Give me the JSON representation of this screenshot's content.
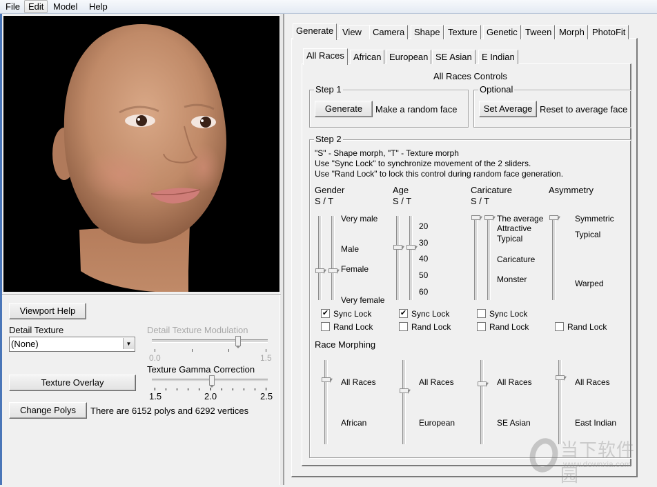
{
  "menu": {
    "items": [
      "File",
      "Edit",
      "Model",
      "Help"
    ],
    "active": "Edit"
  },
  "left_panel": {
    "viewport_help_button": "Viewport Help",
    "detail_texture": {
      "label": "Detail Texture",
      "selected": "(None)"
    },
    "detail_texture_modulation": {
      "label": "Detail Texture Modulation",
      "min_label": "0.0",
      "max_label": "1.5",
      "value_fraction": 0.73,
      "enabled": false
    },
    "texture_overlay_button": "Texture Overlay",
    "texture_gamma_correction": {
      "label": "Texture Gamma Correction",
      "min_label": "1.5",
      "mid_label": "2.0",
      "max_label": "2.5",
      "value": 2.0
    },
    "change_polys_button": "Change Polys",
    "polys_info": "There are 6152 polys and 6292 vertices"
  },
  "main_tabs": [
    {
      "label": "Generate",
      "active": true
    },
    {
      "label": "View"
    },
    {
      "label": "Camera"
    },
    {
      "label": "Shape"
    },
    {
      "label": "Texture"
    },
    {
      "label": "Genetic"
    },
    {
      "label": "Tween"
    },
    {
      "label": "Morph"
    },
    {
      "label": "PhotoFit"
    }
  ],
  "sub_tabs": [
    {
      "label": "All Races",
      "active": true
    },
    {
      "label": "African"
    },
    {
      "label": "European"
    },
    {
      "label": "SE Asian"
    },
    {
      "label": "E Indian"
    }
  ],
  "controls": {
    "title": "All Races Controls",
    "step1": {
      "title": "Step 1",
      "button": "Generate",
      "description": "Make a random face"
    },
    "optional": {
      "title": "Optional",
      "button": "Set Average",
      "description": "Reset to average face"
    },
    "step2": {
      "title": "Step 2",
      "help_lines": [
        "\"S\" - Shape morph, \"T\" - Texture morph",
        "Use \"Sync Lock\" to synchronize movement of the 2 sliders.",
        "Use \"Rand Lock\" to lock this control during random face generation."
      ],
      "gender": {
        "title": "Gender",
        "sub": "S / T",
        "labels": [
          "Very male",
          "Male",
          "Female",
          "Very female"
        ],
        "shape_value": 0.66,
        "texture_value": 0.66,
        "sync_lock": true,
        "rand_lock": false
      },
      "age": {
        "title": "Age",
        "sub": "S / T",
        "labels": [
          "20",
          "30",
          "40",
          "50",
          "60"
        ],
        "shape_value": 0.37,
        "texture_value": 0.37,
        "sync_lock": true,
        "rand_lock": false
      },
      "caricature": {
        "title": "Caricature",
        "sub": "S / T",
        "labels": [
          "The average",
          "Attractive",
          "Typical",
          "Caricature",
          "Monster"
        ],
        "shape_value": 0.0,
        "texture_value": 0.0,
        "sync_lock": false,
        "rand_lock": false
      },
      "asymmetry": {
        "title": "Asymmetry",
        "labels": [
          "Symmetric",
          "Typical",
          "Warped"
        ],
        "value": 0.0,
        "rand_lock": false
      },
      "sync_lock_label": "Sync Lock",
      "rand_lock_label": "Rand Lock"
    },
    "race_morphing": {
      "title": "Race Morphing",
      "sliders": [
        {
          "top": "All Races",
          "bottom": "African",
          "value": 0.22
        },
        {
          "top": "All Races",
          "bottom": "European",
          "value": 0.36
        },
        {
          "top": "All Races",
          "bottom": "SE Asian",
          "value": 0.28
        },
        {
          "top": "All Races",
          "bottom": "East Indian",
          "value": 0.2
        }
      ]
    }
  },
  "watermark": {
    "text": "当下软件园",
    "url_text": "www.downxia.com"
  }
}
